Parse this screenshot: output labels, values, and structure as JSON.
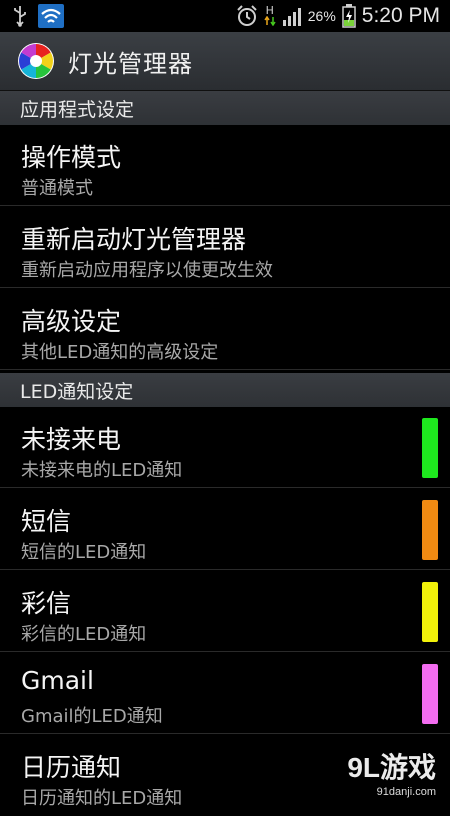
{
  "status_bar": {
    "icons_left": [
      "usb-icon",
      "wifi-icon"
    ],
    "icons_right": [
      "alarm-icon",
      "data-h-icon",
      "signal-icon",
      "battery-charging-icon"
    ],
    "data_label": "H",
    "battery_percent": "26%",
    "time": "5:20 PM"
  },
  "app": {
    "title": "灯光管理器",
    "icon": "rgb-color-wheel-icon"
  },
  "sections": [
    {
      "header": "应用程式设定",
      "items": [
        {
          "title": "操作模式",
          "subtitle": "普通模式"
        },
        {
          "title": "重新启动灯光管理器",
          "subtitle": "重新启动应用程序以使更改生效"
        },
        {
          "title": "高级设定",
          "subtitle": "其他LED通知的高级设定"
        }
      ]
    },
    {
      "header": "LED通知设定",
      "items": [
        {
          "title": "未接来电",
          "subtitle": "未接来电的LED通知",
          "color": "#1ee81e"
        },
        {
          "title": "短信",
          "subtitle": "短信的LED通知",
          "color": "#f08a12"
        },
        {
          "title": "彩信",
          "subtitle": "彩信的LED通知",
          "color": "#f2f20a"
        },
        {
          "title": "Gmail",
          "subtitle": "Gmail的LED通知",
          "color": "#f36cf0"
        },
        {
          "title": "日历通知",
          "subtitle": "日历通知的LED通知"
        }
      ]
    }
  ],
  "watermark": {
    "main": "9L游戏",
    "sub": "91danji.com"
  }
}
